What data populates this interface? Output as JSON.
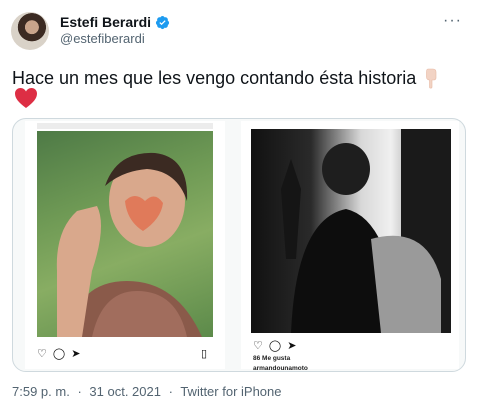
{
  "author": {
    "display_name": "Estefi Berardi",
    "handle": "@estefiberardi",
    "verified_icon": "verified-badge-icon",
    "verified_color": "#1d9bf0"
  },
  "more_label": "···",
  "tweet": {
    "text": "Hace un mes que les vengo contando ésta historia",
    "emoji_1": "backhand-index-pointing-down",
    "emoji_2": "red-heart"
  },
  "media": {
    "left_post": {
      "icons": [
        "heart-outline-icon",
        "comment-icon",
        "share-icon",
        "bookmark-icon"
      ]
    },
    "right_post": {
      "likes": "86 Me gusta",
      "owner": "armandounamoto",
      "icons": [
        "heart-outline-icon",
        "comment-icon",
        "share-icon"
      ]
    }
  },
  "meta": {
    "time": "7:59 p. m.",
    "separator": "·",
    "date": "31 oct. 2021",
    "client": "Twitter for iPhone"
  },
  "colors": {
    "heart": "#dd2e44",
    "text_secondary": "#536471"
  }
}
